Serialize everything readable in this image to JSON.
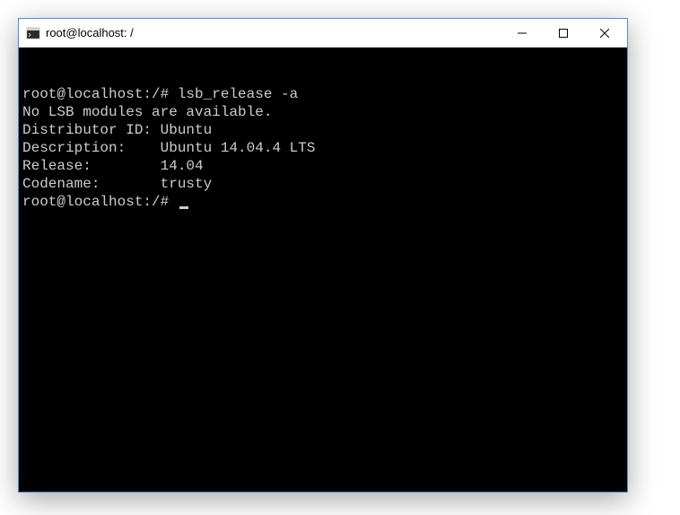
{
  "window": {
    "title": "root@localhost: /"
  },
  "terminal": {
    "lines": [
      {
        "prompt": "root@localhost:/# ",
        "command": "lsb_release -a"
      },
      {
        "output": "No LSB modules are available."
      },
      {
        "output": "Distributor ID: Ubuntu"
      },
      {
        "output": "Description:    Ubuntu 14.04.4 LTS"
      },
      {
        "output": "Release:        14.04"
      },
      {
        "output": "Codename:       trusty"
      },
      {
        "prompt": "root@localhost:/# ",
        "cursor": true
      }
    ]
  }
}
